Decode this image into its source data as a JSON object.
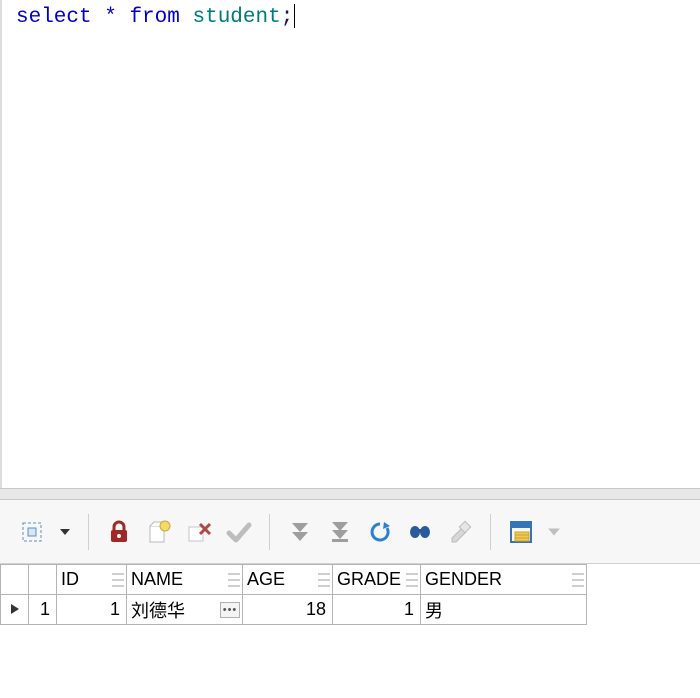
{
  "editor": {
    "tok_select": "select",
    "tok_star": "*",
    "tok_from": "from",
    "tok_table": "student",
    "tok_semi": ";"
  },
  "toolbar": {
    "icons": {
      "select_region": "select-region-icon",
      "dropdown": "dropdown-icon",
      "lock": "lock-icon",
      "new_record": "new-record-icon",
      "delete_record": "delete-record-icon",
      "commit": "commit-icon",
      "fetch_next": "fetch-next-icon",
      "fetch_all": "fetch-all-icon",
      "refresh": "refresh-icon",
      "find": "find-icon",
      "clear": "clear-icon",
      "layout": "layout-icon",
      "layout_dropdown": "layout-dropdown-icon"
    }
  },
  "grid": {
    "columns": [
      "ID",
      "NAME",
      "AGE",
      "GRADE",
      "GENDER"
    ],
    "row_number": "1",
    "cells": {
      "id": "1",
      "name": "刘德华",
      "age": "18",
      "grade": "1",
      "gender": "男"
    }
  }
}
